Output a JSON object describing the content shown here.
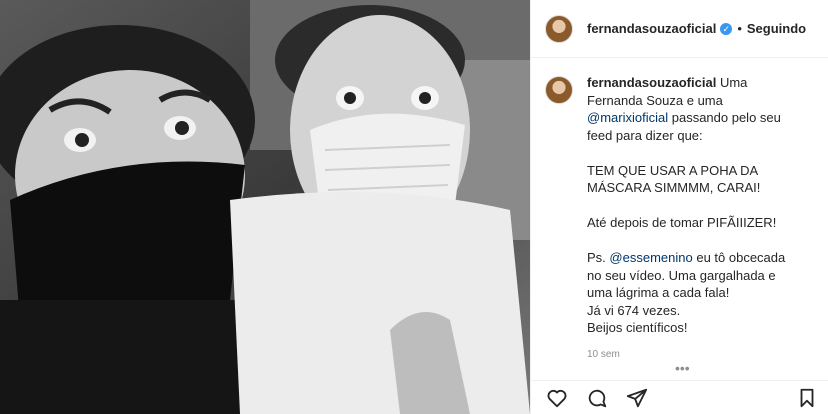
{
  "post": {
    "username": "fernandasouzaoficial",
    "verified_badge": "✓",
    "separator": "•",
    "follow_status": "Seguindo"
  },
  "caption": {
    "username": "fernandasouzaoficial",
    "line1": "Uma Fernanda Souza e uma",
    "mention1": "@marixioficial",
    "line1b": "passando pelo seu feed para dizer que:",
    "line2": "TEM QUE USAR A POHA DA MÁSCARA SIMMMM, CARAI!",
    "line3": "Até depois de tomar PIFÃIIIZER!",
    "ps_prefix": "Ps.",
    "mention2": "@essemenino",
    "ps_text": "eu tô obcecada no seu vídeo. Uma gargalhada e uma lágrima a cada fala!",
    "line5": "Já vi 674 vezes.",
    "line6": "Beijos científicos!"
  },
  "timestamp": "10 sem",
  "icons": {
    "more": "more-horizontal-icon",
    "like": "heart-icon",
    "comment": "comment-icon",
    "share": "paper-plane-icon",
    "save": "bookmark-icon"
  }
}
